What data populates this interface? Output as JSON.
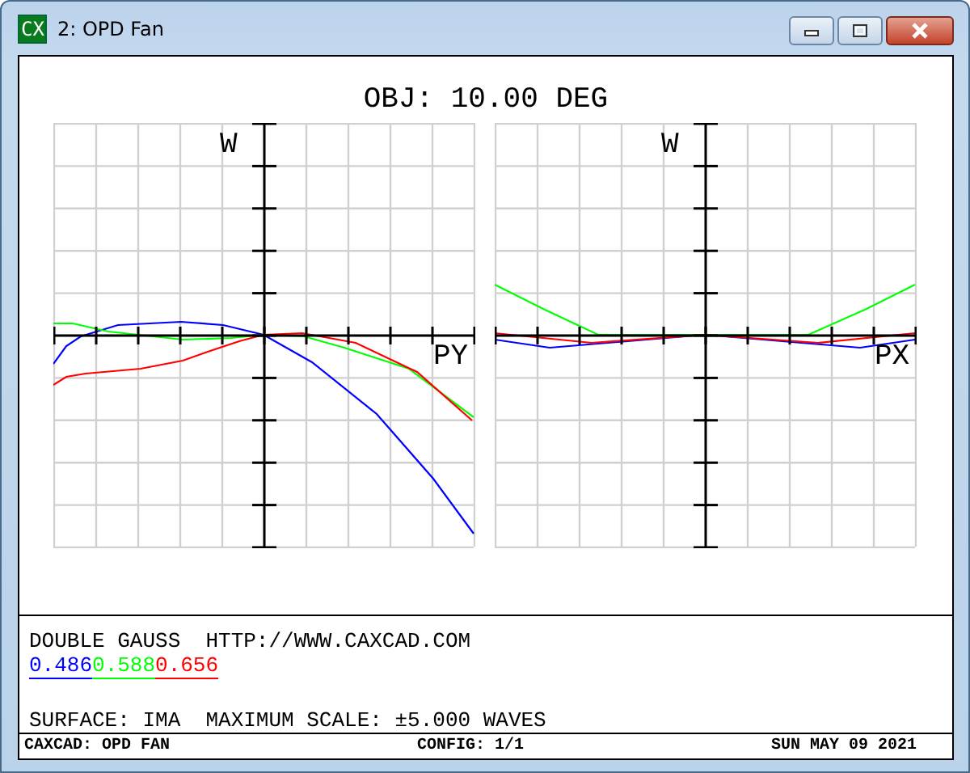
{
  "window": {
    "title": "2: OPD Fan",
    "app_icon": "CX"
  },
  "plot_title": "OBJ: 10.00 DEG",
  "plots": [
    {
      "vertical_label": "W",
      "horizontal_label": "PY",
      "kind": "tangential"
    },
    {
      "vertical_label": "W",
      "horizontal_label": "PX",
      "kind": "sagittal"
    }
  ],
  "legend": {
    "lens": "DOUBLE GAUSS  HTTP://WWW.CAXCAD.COM",
    "wavelengths": [
      {
        "label": "0.486",
        "color": "#0000ff"
      },
      {
        "label": "0.588",
        "color": "#00ff00"
      },
      {
        "label": "0.656",
        "color": "#ff0000"
      }
    ],
    "scale_line": "SURFACE: IMA  MAXIMUM SCALE: ±5.000 WAVES"
  },
  "status_bar": {
    "left": "CAXCAD: OPD FAN",
    "center": "CONFIG: 1/1",
    "right": "SUN MAY 09 2021"
  }
}
